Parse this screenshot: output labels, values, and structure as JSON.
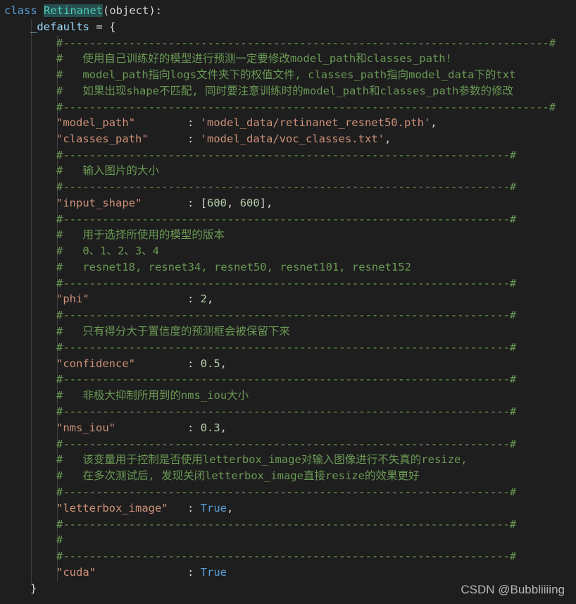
{
  "code": {
    "class_keyword": "class",
    "class_name": "Retinanet",
    "class_base": "(object):",
    "defaults_name": "_defaults",
    "defaults_assign": " = {",
    "closing_brace": "}",
    "sep_long": "#--------------------------------------------------------------------------#",
    "sep_short": "#--------------------------------------------------------------------#",
    "comments": {
      "c1": "#   使用自己训练好的模型进行预测一定要修改model_path和classes_path!",
      "c2": "#   model_path指向logs文件夹下的权值文件, classes_path指向model_data下的txt",
      "c3": "#   如果出现shape不匹配, 同时要注意训练时的model_path和classes_path参数的修改",
      "c4": "#   输入图片的大小",
      "c5": "#   用于选择所使用的模型的版本",
      "c6": "#   0、1、2、3、4",
      "c7": "#   resnet18, resnet34, resnet50, resnet101, resnet152",
      "c8": "#   只有得分大于置信度的预测框会被保留下来",
      "c9": "#   非极大抑制所用到的nms_iou大小",
      "c10": "#   该变量用于控制是否使用letterbox_image对输入图像进行不失真的resize,",
      "c11": "#   在多次测试后, 发现关闭letterbox_image直接resize的效果更好",
      "c12": "#"
    },
    "entries": {
      "model_path_key": "\"model_path\"",
      "model_path_val": "'model_data/retinanet_resnet50.pth'",
      "classes_path_key": "\"classes_path\"",
      "classes_path_val": "'model_data/voc_classes.txt'",
      "input_shape_key": "\"input_shape\"",
      "input_shape_open": "[",
      "input_shape_a": "600",
      "input_shape_b": "600",
      "input_shape_close": "],",
      "phi_key": "\"phi\"",
      "phi_val": "2",
      "confidence_key": "\"confidence\"",
      "confidence_val": "0.5",
      "nms_iou_key": "\"nms_iou\"",
      "nms_iou_val": "0.3",
      "letterbox_key": "\"letterbox_image\"",
      "letterbox_val": "True",
      "cuda_key": "\"cuda\"",
      "cuda_val": "True"
    },
    "colon": ": ",
    "comma": ",",
    "comma_space": ", "
  },
  "watermark": "CSDN @Bubbliiiing",
  "colors": {
    "background": "#1e1e1e",
    "keyword": "#569cd6",
    "class_name": "#4ec9b0",
    "string": "#ce9178",
    "number": "#b5cea8",
    "comment": "#6a9955",
    "variable": "#9cdcfe"
  }
}
